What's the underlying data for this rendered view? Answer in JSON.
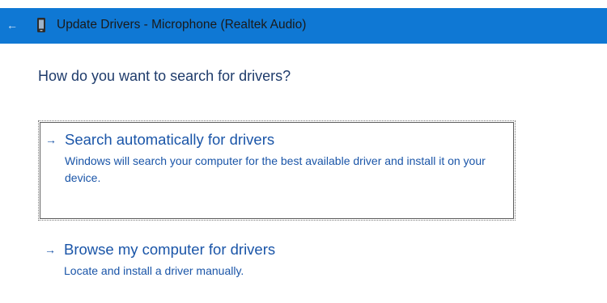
{
  "window": {
    "title": "Update Drivers - Microphone (Realtek Audio)",
    "back_icon": "←",
    "colors": {
      "titlebar": "#0f78d4",
      "link": "#1a55a8",
      "heading": "#1e3b6b"
    }
  },
  "main": {
    "question": "How do you want to search for drivers?",
    "options": [
      {
        "arrow": "→",
        "title": "Search automatically for drivers",
        "description": "Windows will search your computer for the best available driver and install it on your device."
      },
      {
        "arrow": "→",
        "title": "Browse my computer for drivers",
        "description": "Locate and install a driver manually."
      }
    ]
  }
}
